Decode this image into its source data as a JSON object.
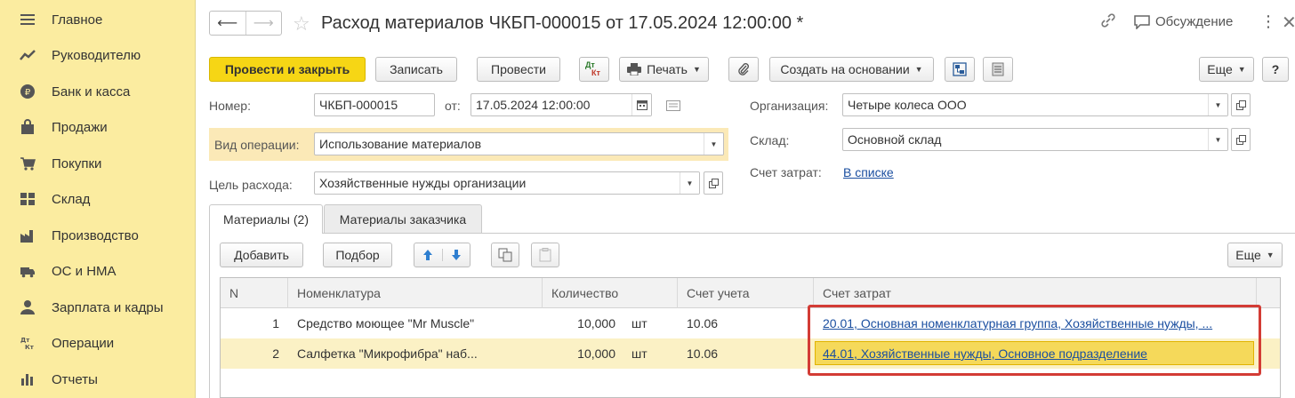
{
  "sidebar": {
    "items": [
      {
        "label": "Главное",
        "icon": "menu-icon"
      },
      {
        "label": "Руководителю",
        "icon": "trend-icon"
      },
      {
        "label": "Банк и касса",
        "icon": "coin-icon"
      },
      {
        "label": "Продажи",
        "icon": "bag-icon"
      },
      {
        "label": "Покупки",
        "icon": "cart-icon"
      },
      {
        "label": "Склад",
        "icon": "warehouse-icon"
      },
      {
        "label": "Производство",
        "icon": "factory-icon"
      },
      {
        "label": "ОС и НМА",
        "icon": "truck-icon"
      },
      {
        "label": "Зарплата и кадры",
        "icon": "person-icon"
      },
      {
        "label": "Операции",
        "icon": "dt-kt-icon"
      },
      {
        "label": "Отчеты",
        "icon": "bar-chart-icon"
      }
    ]
  },
  "header": {
    "title": "Расход материалов ЧКБП-000015 от 17.05.2024 12:00:00 *",
    "discussion_label": "Обсуждение"
  },
  "toolbar": {
    "post_close_label": "Провести и закрыть",
    "save_label": "Записать",
    "post_label": "Провести",
    "dtkt_top": "Дт",
    "dtkt_bottom": "Кт",
    "print_label": "Печать",
    "create_based_label": "Создать на основании",
    "more_label": "Еще",
    "help_label": "?"
  },
  "form": {
    "number_label": "Номер:",
    "number_value": "ЧКБП-000015",
    "from_label": "от:",
    "date_value": "17.05.2024 12:00:00",
    "operation_label": "Вид операции:",
    "operation_value": "Использование материалов",
    "purpose_label": "Цель расхода:",
    "purpose_value": "Хозяйственные нужды организации",
    "org_label": "Организация:",
    "org_value": "Четыре колеса ООО",
    "warehouse_label": "Склад:",
    "warehouse_value": "Основной склад",
    "cost_account_label": "Счет затрат:",
    "cost_account_link": "В списке"
  },
  "tabs": [
    {
      "label": "Материалы (2)",
      "active": true
    },
    {
      "label": "Материалы заказчика",
      "active": false
    }
  ],
  "table_toolbar": {
    "add_label": "Добавить",
    "pick_label": "Подбор",
    "more_label": "Еще"
  },
  "table": {
    "columns": [
      "N",
      "Номенклатура",
      "Количество",
      "Счет учета",
      "Счет затрат"
    ],
    "rows": [
      {
        "n": "1",
        "item": "Средство моющее \"Mr Muscle\"",
        "qty": "10,000",
        "unit": "шт",
        "account": "10.06",
        "cost_account": "20.01, Основная номенклатурная группа, Хозяйственные нужды, ..."
      },
      {
        "n": "2",
        "item": "Салфетка \"Микрофибра\" наб...",
        "qty": "10,000",
        "unit": "шт",
        "account": "10.06",
        "cost_account": "44.01, Хозяйственные нужды, Основное подразделение"
      }
    ]
  },
  "colors": {
    "sidebar_bg": "#fbeca0",
    "primary_button": "#f6d615",
    "link": "#1b4fa0",
    "selected_row": "#fbf1c5",
    "highlight_border": "#d33c35"
  }
}
